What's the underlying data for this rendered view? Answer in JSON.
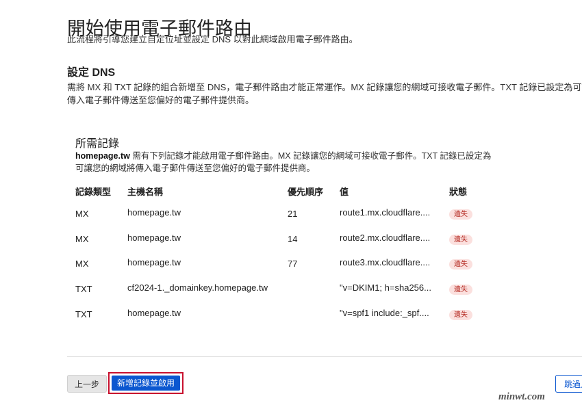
{
  "header": {
    "title": "開始使用電子郵件路由",
    "intro": "此流程將引導您建立自定位址並設定 DNS 以對此網域啟用電子郵件路由。"
  },
  "dns_section": {
    "title": "設定 DNS",
    "desc_line1": "需將 MX 和 TXT 記錄的組合新增至 DNS，電子郵件路由才能正常運作。MX 記錄讓您的網域可接收電子郵件。TXT 記錄已設定為可讓您",
    "desc_line2": "傳入電子郵件傳送至您偏好的電子郵件提供商。"
  },
  "records": {
    "title": "所需記錄",
    "domain": "homepage.tw",
    "desc_line1_rest": " 需有下列記錄才能啟用電子郵件路由。MX 記錄讓您的網域可接收電子郵件。TXT 記錄已設定為",
    "desc_line2": "可讓您的網域將傳入電子郵件傳送至您偏好的電子郵件提供商。",
    "columns": {
      "type": "記錄類型",
      "host": "主機名稱",
      "priority": "優先順序",
      "value": "值",
      "status": "狀態"
    },
    "rows": [
      {
        "type": "MX",
        "host": "homepage.tw",
        "priority": "21",
        "value": "route1.mx.cloudflare....",
        "status": "遺失"
      },
      {
        "type": "MX",
        "host": "homepage.tw",
        "priority": "14",
        "value": "route2.mx.cloudflare....",
        "status": "遺失"
      },
      {
        "type": "MX",
        "host": "homepage.tw",
        "priority": "77",
        "value": "route3.mx.cloudflare....",
        "status": "遺失"
      },
      {
        "type": "TXT",
        "host": "cf2024-1._domainkey.homepage.tw",
        "priority": "",
        "value": "\"v=DKIM1; h=sha256...",
        "status": "遺失"
      },
      {
        "type": "TXT",
        "host": "homepage.tw",
        "priority": "",
        "value": "\"v=spf1 include:_spf....",
        "status": "遺失"
      }
    ]
  },
  "footer": {
    "back_label": "上一步",
    "add_enable_label": "新增記錄並啟用",
    "skip_label": "跳過入"
  },
  "watermark": "minwt.com",
  "colors": {
    "primary": "#0b57d0",
    "badge_bg": "#fbe0de",
    "badge_text": "#b3261e",
    "highlight_border": "#c8102e"
  }
}
